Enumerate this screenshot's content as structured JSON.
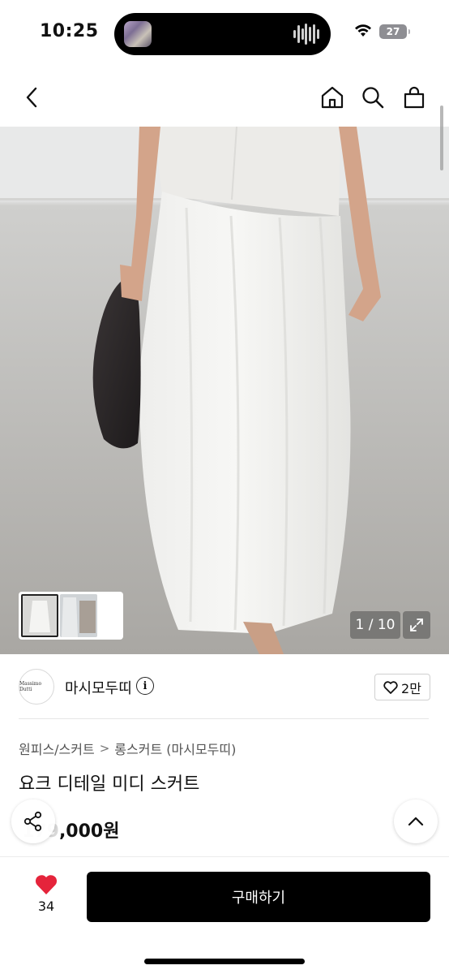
{
  "status_bar": {
    "time": "10:25",
    "battery": "27",
    "wifi_icon": "wifi-icon",
    "battery_icon": "battery-icon"
  },
  "nav": {
    "back_icon": "chevron-left-icon",
    "home_icon": "home-icon",
    "search_icon": "search-icon",
    "bag_icon": "shopping-bag-icon"
  },
  "gallery": {
    "counter": "1 / 10",
    "current_index": 1,
    "total": 10,
    "expand_icon": "expand-icon"
  },
  "seller": {
    "logo_text": "Massimo Dutti",
    "name": "마시모두띠",
    "info_icon": "info-icon",
    "like_count": "2만"
  },
  "product": {
    "breadcrumb": [
      "원피스/스커트",
      "롱스커트 (마시모두띠)"
    ],
    "breadcrumb_separator": ">",
    "title": "요크 디테일 미디 스커트",
    "price_hidden_prefix": "179",
    "price_visible": ",000원"
  },
  "floating": {
    "share_icon": "share-icon",
    "scroll_top_icon": "chevron-up-icon"
  },
  "bottom_bar": {
    "heart_icon": "heart-icon",
    "wish_count": "34",
    "buy_label": "구매하기"
  },
  "colors": {
    "accent_heart": "#e5243b",
    "buy_button": "#000000",
    "background": "#ffffff"
  }
}
